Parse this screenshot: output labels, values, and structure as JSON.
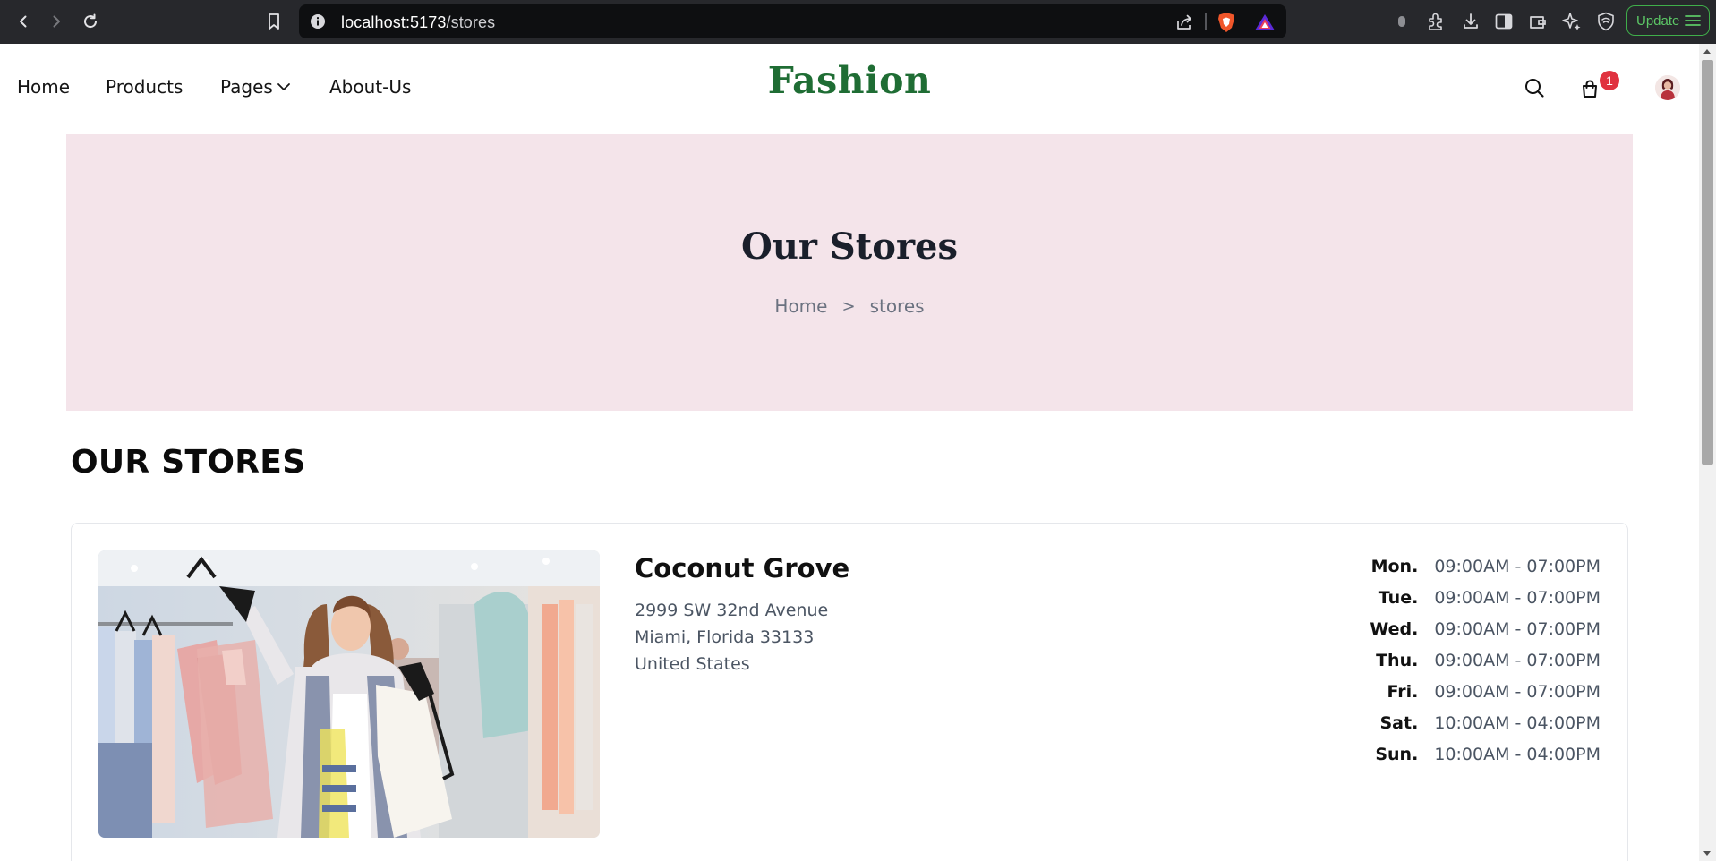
{
  "browser": {
    "url_host": "localhost:5173",
    "url_path": "/stores",
    "update_label": "Update"
  },
  "header": {
    "brand": "Fashion",
    "nav": [
      {
        "label": "Home"
      },
      {
        "label": "Products"
      },
      {
        "label": "Pages"
      },
      {
        "label": "About-Us"
      }
    ],
    "cart_count": "1"
  },
  "hero": {
    "title": "Our Stores",
    "breadcrumb": {
      "home": "Home",
      "separator": ">",
      "current": "stores"
    }
  },
  "stores_section": {
    "title": "OUR STORES",
    "stores": [
      {
        "name": "Coconut Grove",
        "address": [
          "2999 SW 32nd Avenue",
          "Miami, Florida 33133",
          "United States"
        ],
        "hours": [
          {
            "day": "Mon.",
            "time": "09:00AM - 07:00PM"
          },
          {
            "day": "Tue.",
            "time": "09:00AM - 07:00PM"
          },
          {
            "day": "Wed.",
            "time": "09:00AM - 07:00PM"
          },
          {
            "day": "Thu.",
            "time": "09:00AM - 07:00PM"
          },
          {
            "day": "Fri.",
            "time": "09:00AM - 07:00PM"
          },
          {
            "day": "Sat.",
            "time": "10:00AM - 04:00PM"
          },
          {
            "day": "Sun.",
            "time": "10:00AM - 04:00PM"
          }
        ]
      }
    ]
  },
  "colors": {
    "brand_green": "#1f6d34",
    "hero_bg": "#f4e4ea",
    "badge_red": "#e0323f",
    "update_green": "#3fae4a"
  },
  "icons": {
    "back": "chevron-left-icon",
    "forward": "chevron-right-icon",
    "reload": "reload-icon",
    "bookmark": "bookmark-icon",
    "site_info": "info-icon",
    "share": "share-icon",
    "brave": "brave-shield-icon",
    "rewards": "brave-rewards-icon",
    "search": "search-icon",
    "cart": "shopping-bag-icon"
  }
}
